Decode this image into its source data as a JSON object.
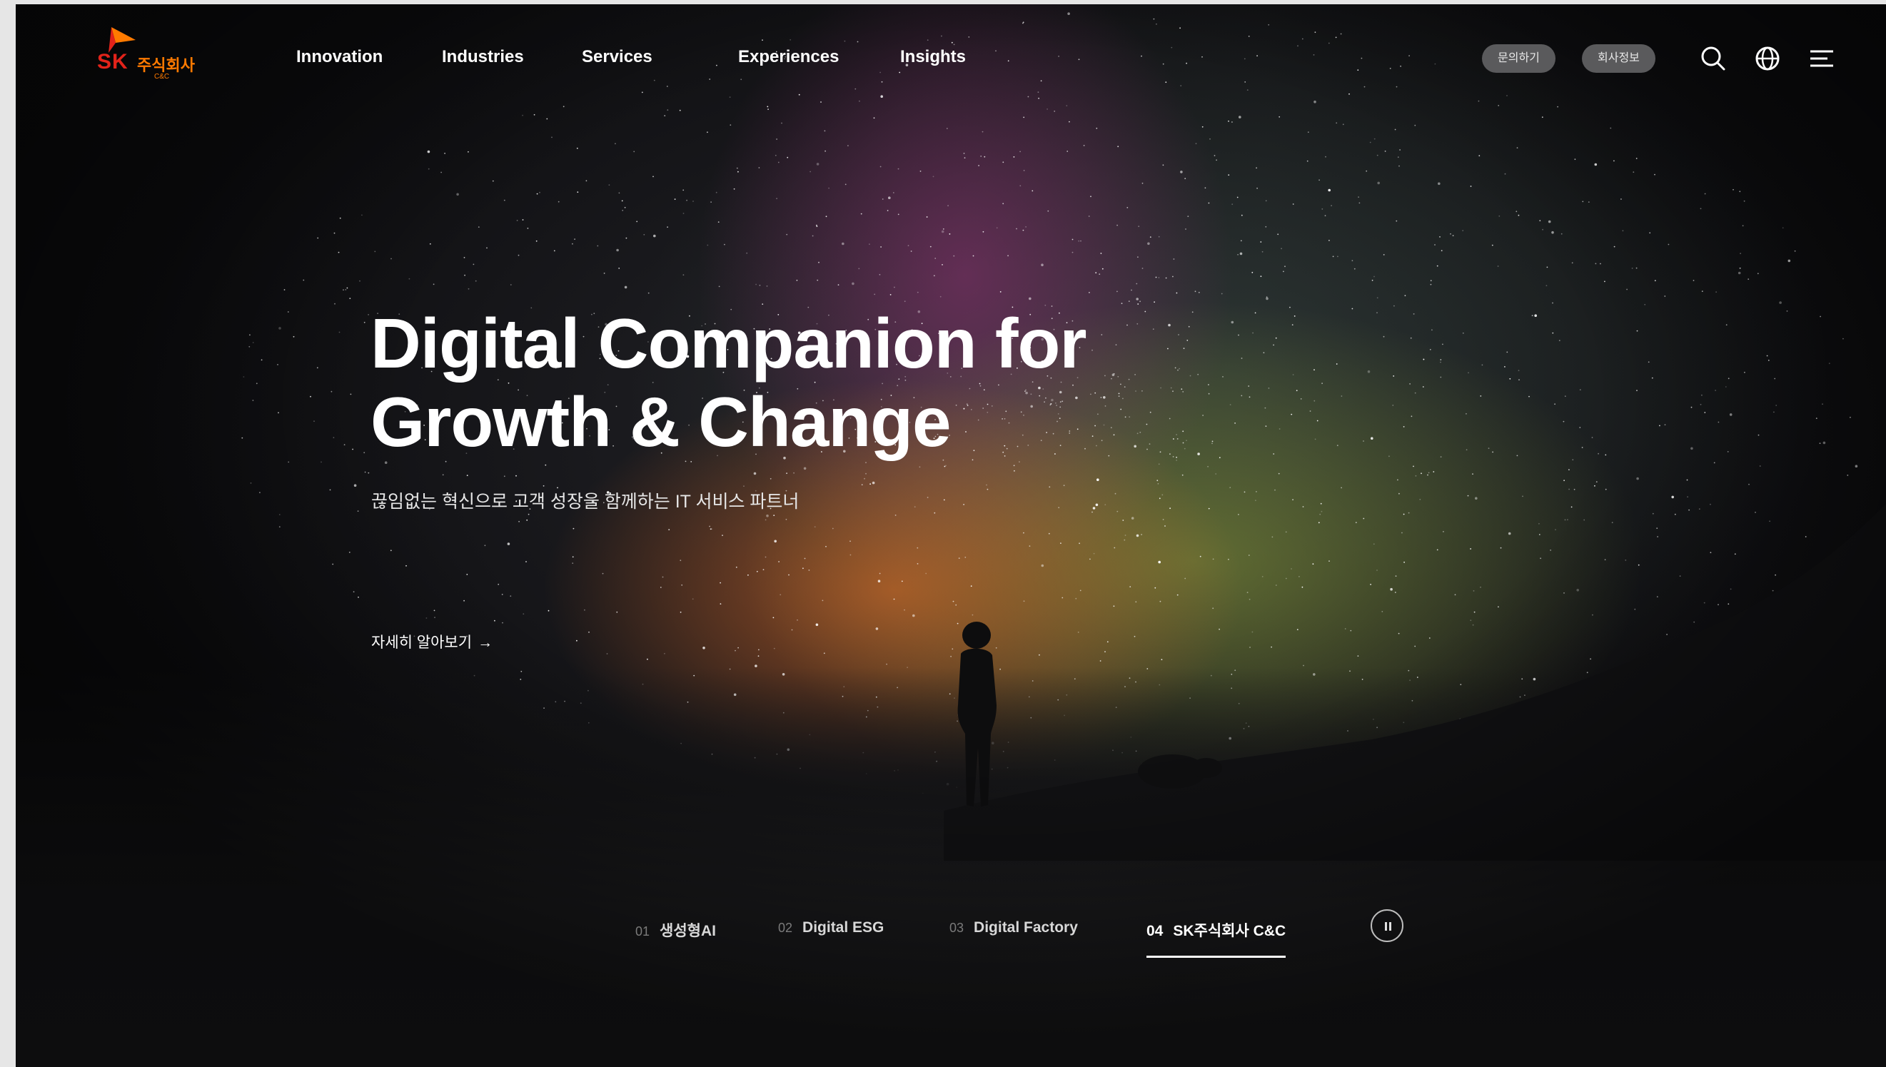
{
  "brand": {
    "logo_sk": "SK",
    "logo_kr": "주식회사",
    "logo_cc": "C&C",
    "logo_colors": {
      "red": "#e2231a",
      "orange": "#ff7a00"
    }
  },
  "nav": {
    "items": [
      {
        "label": "Innovation"
      },
      {
        "label": "Industries"
      },
      {
        "label": "Services"
      },
      {
        "label": "Experiences"
      },
      {
        "label": "Insights"
      }
    ]
  },
  "header_actions": {
    "contact_label": "문의하기",
    "company_label": "회사정보",
    "icons": [
      "search-icon",
      "globe-icon",
      "menu-icon"
    ]
  },
  "hero": {
    "title_line1": "Digital Companion for",
    "title_line2": "Growth & Change",
    "subtitle": "끊임없는 혁신으로 고객 성장을 함께하는 IT 서비스 파트너",
    "cta_label": "자세히 알아보기",
    "cta_arrow": "→"
  },
  "slides": {
    "tabs": [
      {
        "num": "01",
        "label": "생성형AI",
        "active": false
      },
      {
        "num": "02",
        "label": "Digital ESG",
        "active": false
      },
      {
        "num": "03",
        "label": "Digital Factory",
        "active": false
      },
      {
        "num": "04",
        "label": "SK주식회사 C&C",
        "active": true
      }
    ],
    "control_icon": "pause-icon"
  },
  "colors": {
    "background": "#0b0b0c",
    "text": "#ffffff",
    "pill_bg": "#5a5a5c"
  }
}
